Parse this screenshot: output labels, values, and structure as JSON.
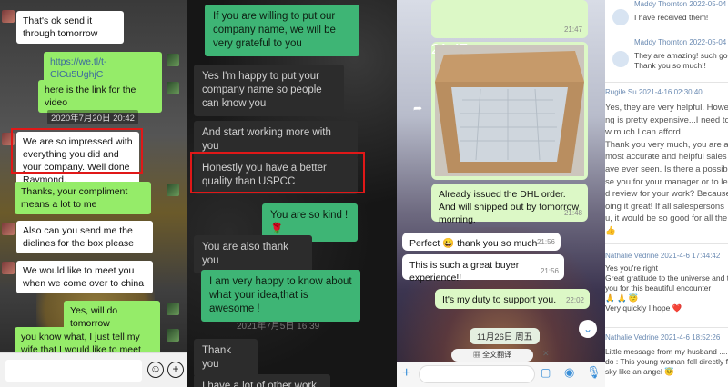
{
  "panel1": {
    "messages": [
      "That's ok send it through tomorrow",
      "https://we.tl/t-ClCu5UghjC",
      "here is the link for the video",
      "We are so impressed with everything you did and your company. Well done Raymond.",
      "Thanks, your compliment means a lot to me",
      "Also can you send me the dielines for the box please",
      "We would like to meet you when we come over to china",
      "Yes, will do tomorrow",
      "you know what, I just tell my wife that I would like to meet you when"
    ],
    "timestamp": "2020年7月20日 20:42",
    "emoji_icon": "smile-icon",
    "plus_icon": "plus-icon"
  },
  "panel2": {
    "messages": [
      "If you are willing to put our company name, we will be very grateful to you",
      "Yes I'm happy to put your company name so people can know you",
      "And start working more with you",
      "Honestly you have a better quality than USPCC",
      "You are so kind !",
      "You are also thank you",
      "I am very happy to know about what your idea,that is awesome !",
      "Thank you",
      "I have a lot of other work"
    ],
    "timestamp": "2021年7月5日 16:39"
  },
  "panel3": {
    "photo_time_1": "21:47",
    "photo_time_2": "21:47",
    "messages": [
      {
        "text": "Already issued the DHL order. And will shipped out by tomorrow morning.",
        "time": "21:48"
      },
      {
        "text": "Perfect 😀 thank you so much",
        "time": "21:56"
      },
      {
        "text": "This is such a great buyer experience!!",
        "time": "21:56"
      },
      {
        "text": "It's my duty to support you.",
        "time": "22:02"
      }
    ],
    "date_pill": "11月26日 周五",
    "translate_label": "全文翻译"
  },
  "panel4": {
    "r1_name": "Maddy Thornton   2022-05-04 17:26",
    "r1_text": "I have received them!",
    "r2_name": "Maddy Thornton   2022-05-04 17:26",
    "r2_text_1": "They are amazing! such good quality!",
    "r2_text_2": "Thank you so much!!",
    "r3_name": "Rugile Su   2021-4-16 02:30:40",
    "r3_lines": [
      "Yes, they are very helpful. Howe",
      "ng is pretty expensive...I need to",
      "w much I can afford.",
      "Thank you very much, you are a",
      "most accurate and helpful sales",
      "ave ever seen. Is there a possibl",
      "se you for your manager or to le",
      "d review for your work? Because",
      "oing it great! If all salespersons",
      "u, it would be so good for all the",
      "👍"
    ],
    "r4_name": "Nathalie Vedrine   2021-4-6 17:44:42",
    "r4_lines": [
      "Yes you're right",
      "Great gratitude to the universe and to",
      "you for this beautiful encounter",
      "🙏 🙏 😇",
      "Very quickly I hope ❤️"
    ],
    "r5_name": "Nathalie Vedrine   2021-4-6 18:52:26",
    "r5_lines": [
      "Little message from my husband ..... H",
      "do : This young woman fell directly from",
      "sky like an angel 😇"
    ]
  }
}
